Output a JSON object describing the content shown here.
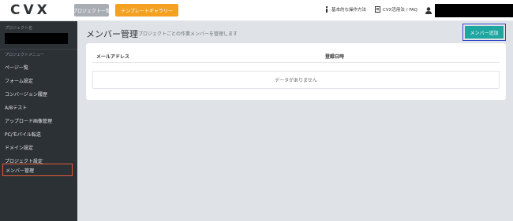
{
  "header": {
    "logo_letters": [
      "C",
      "V",
      "X"
    ],
    "projects_button": "プロジェクト一覧",
    "templates_button": "テンプレートギャラリー",
    "help_link": "基本的な操作方法",
    "faq_link": "CVX活用法 / FAQ",
    "user_menu_caret": "▾"
  },
  "sidebar": {
    "project_name_label": "プロジェクト名",
    "project_menu_label": "プロジェクトメニュー",
    "items": [
      {
        "label": "ページ一覧"
      },
      {
        "label": "フォーム設定"
      },
      {
        "label": "コンバージョン履歴"
      },
      {
        "label": "A/Bテスト"
      },
      {
        "label": "アップロード画像管理"
      },
      {
        "label": "PC/モバイル転送"
      },
      {
        "label": "ドメイン設定"
      },
      {
        "label": "プロジェクト設定"
      },
      {
        "label": "メンバー管理",
        "active": true
      }
    ]
  },
  "main": {
    "title": "メンバー管理",
    "subtitle": "プロジェクトごとの作業メンバーを管理します",
    "add_button": "メンバー追加",
    "table": {
      "columns": [
        "メールアドレス",
        "登録日時"
      ],
      "empty_message": "データがありません"
    }
  },
  "colors": {
    "accent_teal": "#1fa6a0",
    "orange": "#f4a122",
    "sidebar_bg": "#2c3136",
    "highlight_red": "#e05a3a",
    "highlight_blue": "#2f4cc9"
  },
  "icons": [
    "info-book-icon",
    "faq-doc-icon",
    "user-icon"
  ]
}
